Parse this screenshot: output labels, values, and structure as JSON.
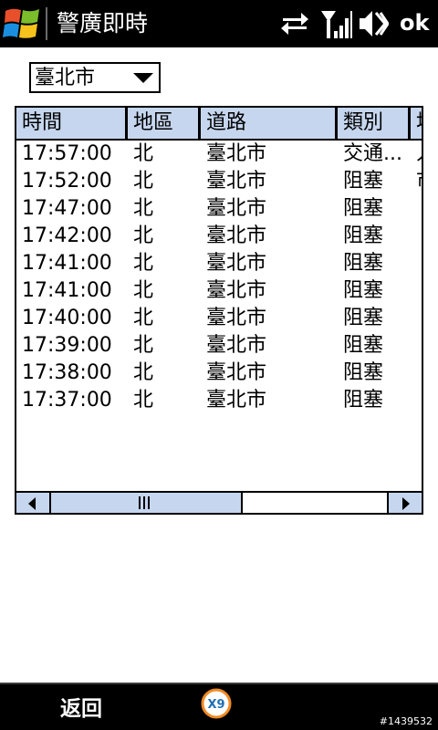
{
  "titlebar": {
    "title": "警廣即時",
    "ok_label": "ok",
    "icons": [
      "windows-start-icon",
      "data-connection-icon",
      "signal-strength-icon",
      "volume-icon"
    ]
  },
  "filter": {
    "city_selected": "臺北市"
  },
  "table": {
    "columns": [
      "時間",
      "地區",
      "道路",
      "類別",
      "地"
    ],
    "rows": [
      {
        "time": "17:57:00",
        "area": "北",
        "road": "臺北市",
        "category": "交通...",
        "extra": "人"
      },
      {
        "time": "17:52:00",
        "area": "北",
        "road": "臺北市",
        "category": "阻塞",
        "extra": "市"
      },
      {
        "time": "17:47:00",
        "area": "北",
        "road": "臺北市",
        "category": "阻塞",
        "extra": ""
      },
      {
        "time": "17:42:00",
        "area": "北",
        "road": "臺北市",
        "category": "阻塞",
        "extra": ""
      },
      {
        "time": "17:41:00",
        "area": "北",
        "road": "臺北市",
        "category": "阻塞",
        "extra": ""
      },
      {
        "time": "17:41:00",
        "area": "北",
        "road": "臺北市",
        "category": "阻塞",
        "extra": ""
      },
      {
        "time": "17:40:00",
        "area": "北",
        "road": "臺北市",
        "category": "阻塞",
        "extra": ""
      },
      {
        "time": "17:39:00",
        "area": "北",
        "road": "臺北市",
        "category": "阻塞",
        "extra": ""
      },
      {
        "time": "17:38:00",
        "area": "北",
        "road": "臺北市",
        "category": "阻塞",
        "extra": ""
      },
      {
        "time": "17:37:00",
        "area": "北",
        "road": "臺北市",
        "category": "阻塞",
        "extra": ""
      }
    ],
    "header_color": "#c6d6ee"
  },
  "softkeys": {
    "left_label": "返回",
    "logo_text": "X9"
  },
  "watermark": "#1439532"
}
